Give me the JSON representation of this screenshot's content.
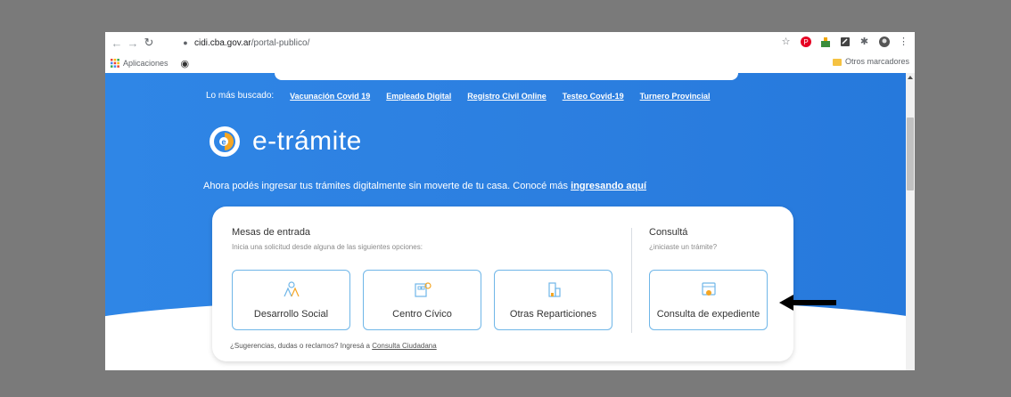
{
  "browser": {
    "url_host": "cidi.cba.gov.ar",
    "url_path": "/portal-publico/",
    "bookmarks_apps_label": "Aplicaciones",
    "bookmarks_other_label": "Otros marcadores"
  },
  "quick_links": {
    "label": "Lo más buscado:",
    "items": [
      "Vacunación Covid 19",
      "Empleado Digital",
      "Registro Civil Online",
      "Testeo Covid-19",
      "Turnero Provincial"
    ]
  },
  "brand": {
    "name": "e-trámite"
  },
  "tagline": {
    "text": "Ahora podés ingresar tus trámites digitalmente sin moverte de tu casa. Conocé más ",
    "link": "ingresando aquí"
  },
  "mesas": {
    "title": "Mesas de entrada",
    "subtitle": "Inicia una solicitud desde alguna de las siguientes opciones:",
    "options": [
      "Desarrollo Social",
      "Centro Cívico",
      "Otras Reparticiones"
    ]
  },
  "consulta": {
    "title": "Consultá",
    "subtitle": "¿iniciaste un trámite?",
    "button": "Consulta de expediente"
  },
  "footer": {
    "text": "¿Sugerencias, dudas o reclamos? Ingresá a ",
    "link": "Consulta Ciudadana"
  },
  "colors": {
    "hero_blue": "#2f86e6",
    "card_border": "#6fb6e8",
    "accent_orange": "#f5a623"
  },
  "icons": [
    "back-icon",
    "forward-icon",
    "reload-icon",
    "lock-icon",
    "star-icon",
    "pinterest-icon",
    "extension-icon",
    "bookmark-folder-icon",
    "e-tramite-logo",
    "desarrollo-social-icon",
    "centro-civico-icon",
    "otras-reparticiones-icon",
    "consulta-expediente-icon",
    "arrow-left-icon"
  ]
}
